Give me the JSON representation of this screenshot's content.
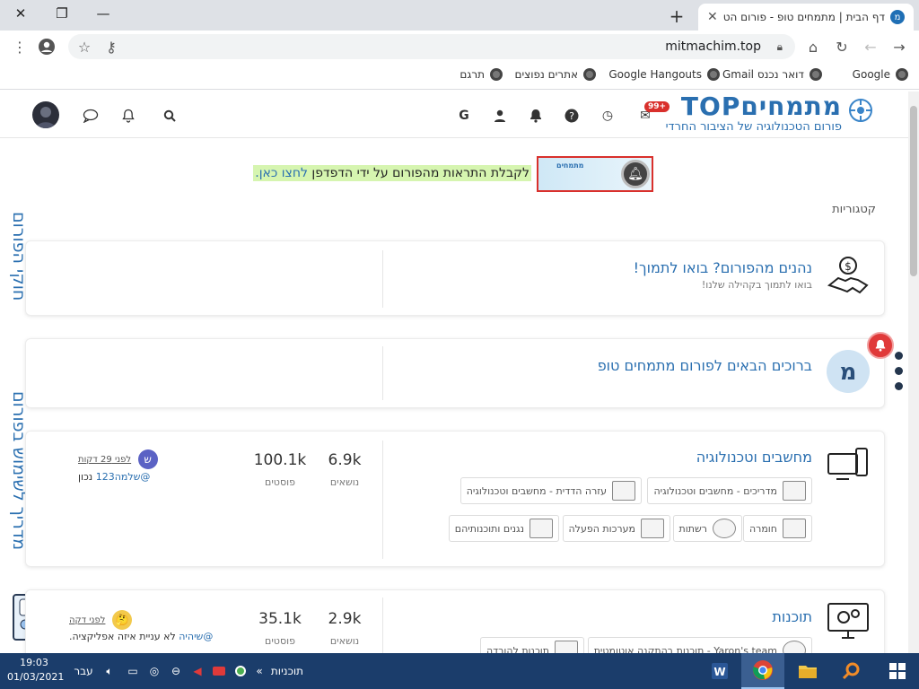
{
  "browser": {
    "tab_title": "דף הבית | מתמחים טופ - פורום הט",
    "url": "mitmachim.top",
    "bookmarks": [
      "Google",
      "דואר נכנס Gmail",
      "Google Hangouts",
      "אתרים נפוצים",
      "תרגם"
    ]
  },
  "site": {
    "logo_text": "מתמחיםTOP",
    "logo_sub": "פורום הטכנולוגיה של הציבור החרדי",
    "notify_badge": "99+",
    "notice_img_label": "מתמחים",
    "notice_text": "לקבלת התראות מהפורום על ידי הדפדפן",
    "notice_link": "לחצו כאן.",
    "categories_label": "קטגוריות",
    "side_left_top": "חוקי הפורום",
    "side_left_bottom": "מדריך לשימוש בפורום"
  },
  "cards": [
    {
      "title": "נהנים מהפורום? בואו לתמוך!",
      "desc": "בואו לתמוך בקהילה שלנו!"
    },
    {
      "title": "ברוכים הבאים לפורום מתמחים טופ"
    },
    {
      "title": "מחשבים וטכנולוגיה",
      "topics": "6.9k",
      "topics_label": "נושאים",
      "posts": "100.1k",
      "posts_label": "פוסטים",
      "subs": [
        "מדריכים - מחשבים וטכנולוגיה",
        "עזרה הדדית - מחשבים וטכנולוגיה",
        "חומרה",
        "רשתות",
        "מערכות הפעלה",
        "נגנים ותוכנותיהם"
      ],
      "last_avatar": "ש",
      "last_time": "לפני 29 דקות",
      "last_user": "@שלמה123",
      "last_text": "נכון"
    },
    {
      "title": "תוכנות",
      "topics": "2.9k",
      "topics_label": "נושאים",
      "posts": "35.1k",
      "posts_label": "פוסטים",
      "subs": [
        "Yaron's team - תוכנות בהתקנה אוטומטית",
        "תוכנות להורדה"
      ],
      "last_time": "לפני דקה",
      "last_user": "@שיהיה",
      "last_text": "לא עניית איזה אפליקציה."
    }
  ],
  "taskbar": {
    "time": "19:03",
    "date": "01/03/2021",
    "lang": "עבר",
    "programs": "תוכניות"
  }
}
